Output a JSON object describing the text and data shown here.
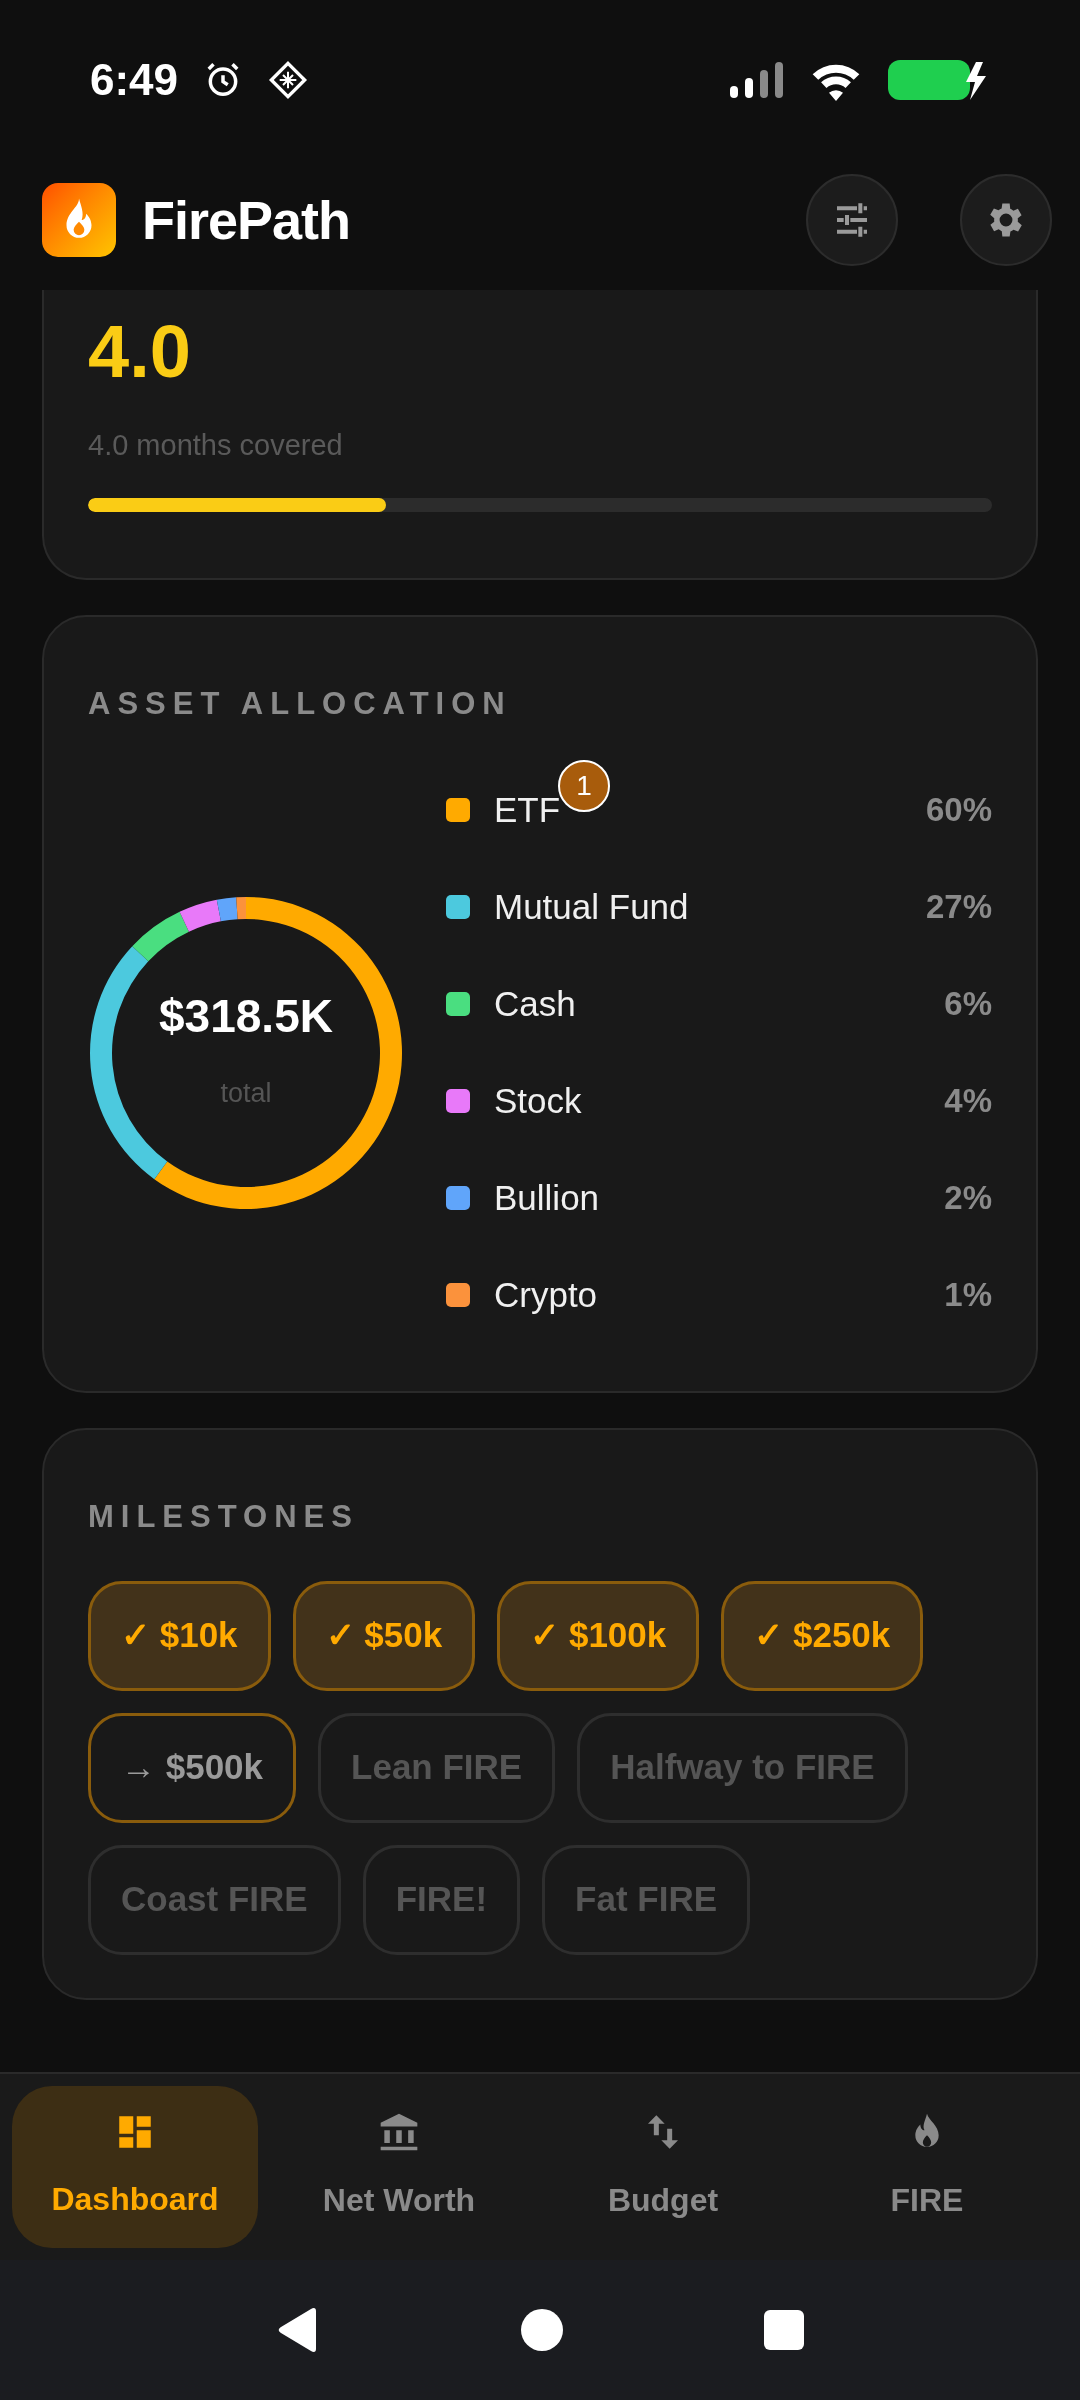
{
  "status_bar": {
    "time": "6:49"
  },
  "header": {
    "title": "FirePath"
  },
  "emergency_fund": {
    "value": "4.0",
    "caption": "4.0 months covered",
    "level": 0.33
  },
  "asset_allocation": {
    "title": "ASSET ALLOCATION",
    "total": "$318.5K",
    "total_caption": "total",
    "chart_data": {
      "type": "donut",
      "categories": [
        "ETF",
        "Mutual Fund",
        "Cash",
        "Stock",
        "Bullion",
        "Crypto"
      ],
      "values": [
        60,
        27,
        6,
        4,
        2,
        1
      ]
    },
    "legend": [
      {
        "percent": "60%",
        "color": "#ffaa00"
      },
      {
        "percent": "27%",
        "color": "#4cc9de"
      },
      {
        "percent": "6%",
        "color": "#4ade80"
      },
      {
        "percent": "4%",
        "color": "#e879f9"
      },
      {
        "percent": "2%",
        "color": "#60a5fa"
      },
      {
        "percent": "1%",
        "color": "#fb923c"
      }
    ]
  },
  "touch_marker": {
    "label": "1"
  },
  "milestones": {
    "title": "MILESTONES",
    "items": [
      {
        "label": "✓ $10k",
        "kind": "achieved"
      },
      {
        "label": "✓ $50k",
        "kind": "achieved"
      },
      {
        "label": "✓ $100k",
        "kind": "achieved"
      },
      {
        "label": "✓ $250k",
        "kind": "achieved"
      },
      {
        "label": "→ $500k",
        "kind": "next"
      },
      {
        "label": "Lean FIRE",
        "kind": "locked"
      },
      {
        "label": "Halfway to FIRE",
        "kind": "locked"
      },
      {
        "label": "Coast FIRE",
        "kind": "locked"
      },
      {
        "label": "FIRE!",
        "kind": "locked"
      },
      {
        "label": "Fat FIRE",
        "kind": "locked"
      }
    ]
  },
  "bottom_nav": [
    {
      "label": "Dashboard",
      "selected": true
    },
    {
      "label": "Net Worth",
      "selected": false
    },
    {
      "label": "Budget",
      "selected": false
    },
    {
      "label": "FIRE",
      "selected": false
    }
  ]
}
